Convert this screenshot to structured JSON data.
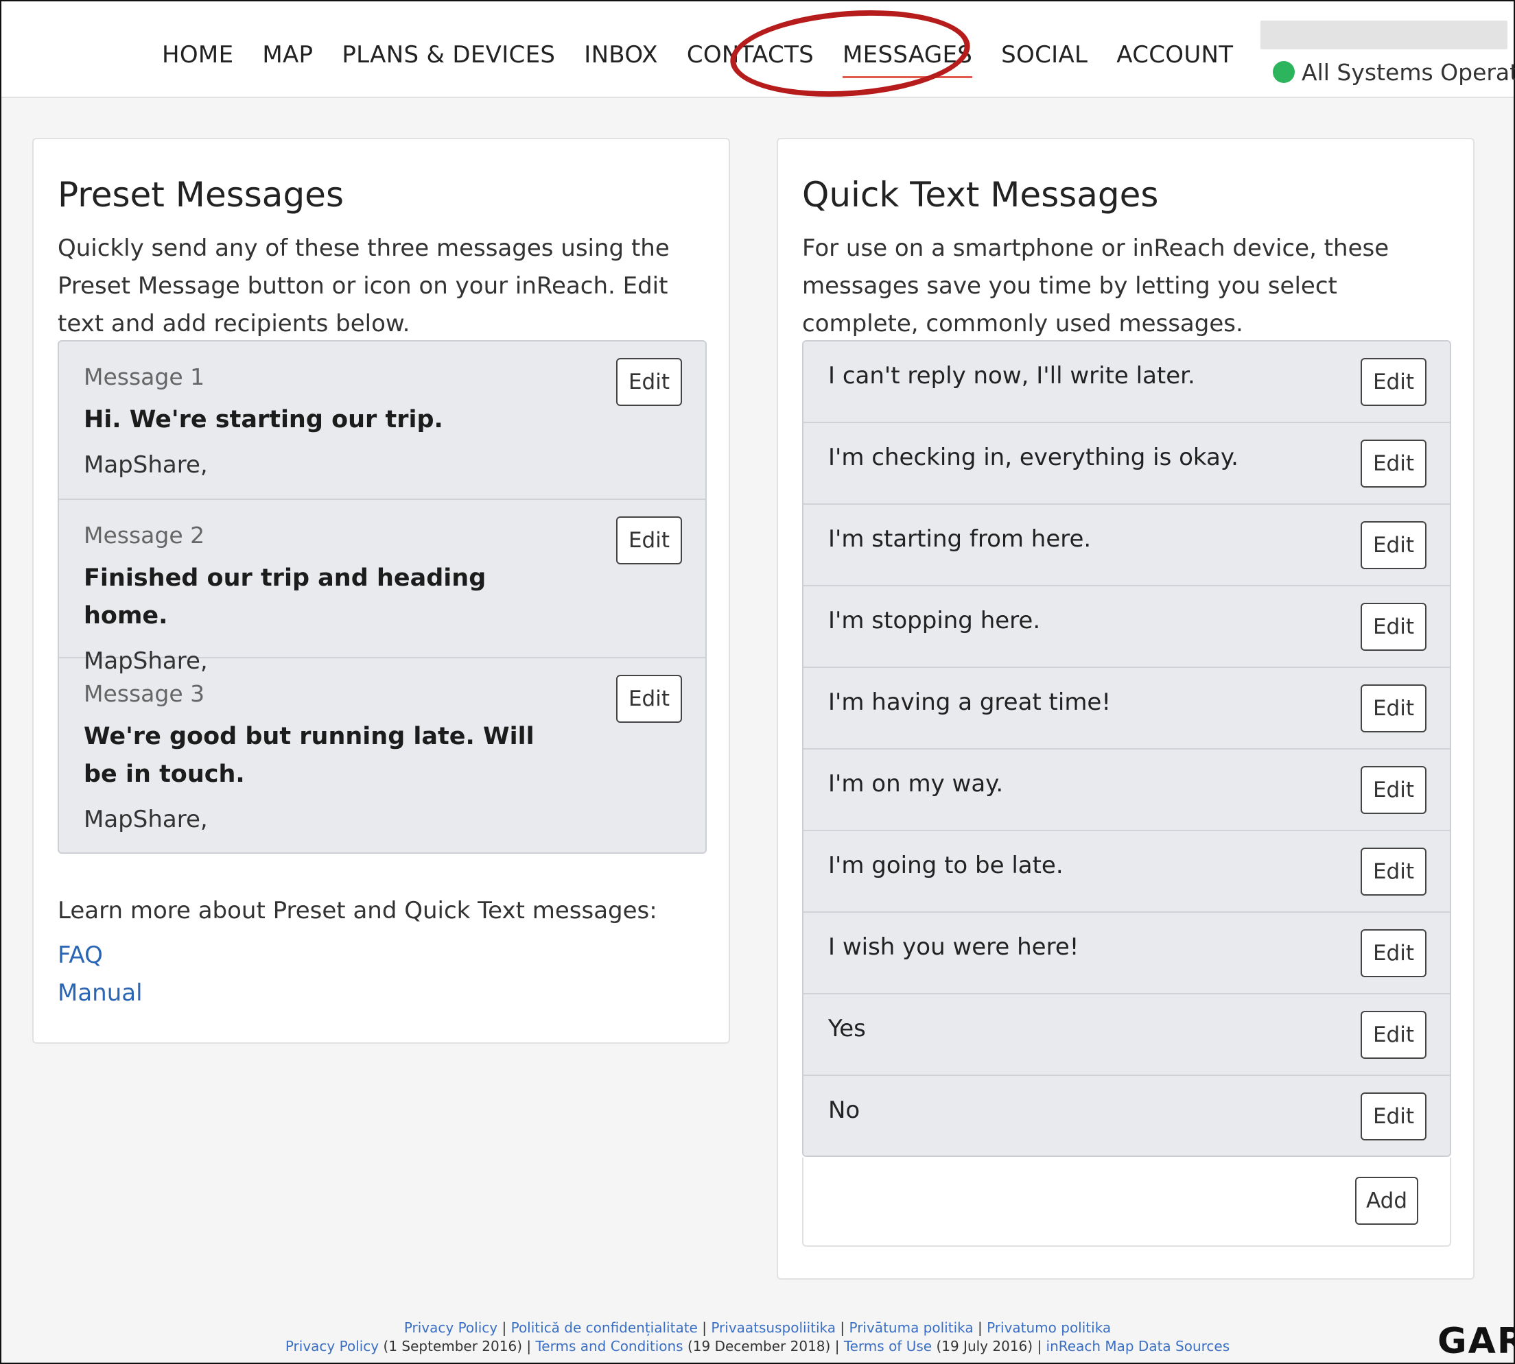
{
  "nav": {
    "items": [
      "HOME",
      "MAP",
      "PLANS & DEVICES",
      "INBOX",
      "CONTACTS",
      "MESSAGES",
      "SOCIAL",
      "ACCOUNT"
    ],
    "active": "MESSAGES"
  },
  "status": {
    "text": "All Systems Operati",
    "color": "#2db55d"
  },
  "annotation": {
    "color": "#b71c1c"
  },
  "preset": {
    "title": "Preset Messages",
    "description": "Quickly send any of these three messages using the Preset Message button or icon on your inReach. Edit text and add recipients below.",
    "messages": [
      {
        "label": "Message 1",
        "text": "Hi. We're starting our trip.",
        "recipients": "MapShare,",
        "edit_label": "Edit"
      },
      {
        "label": "Message 2",
        "text": "Finished our trip and heading home.",
        "recipients": "MapShare,",
        "edit_label": "Edit"
      },
      {
        "label": "Message 3",
        "text": "We're good but running late. Will be in touch.",
        "recipients": "MapShare,",
        "edit_label": "Edit"
      }
    ],
    "learn_more": "Learn more about Preset and Quick Text messages:",
    "links": {
      "faq": "FAQ",
      "manual": "Manual"
    }
  },
  "quick": {
    "title": "Quick Text Messages",
    "description": "For use on a smartphone or inReach device, these messages save you time by letting you select complete, commonly used messages.",
    "messages": [
      {
        "text": "I can't reply now, I'll write later.",
        "edit_label": "Edit"
      },
      {
        "text": "I'm checking in, everything is okay.",
        "edit_label": "Edit"
      },
      {
        "text": "I'm starting from here.",
        "edit_label": "Edit"
      },
      {
        "text": "I'm stopping here.",
        "edit_label": "Edit"
      },
      {
        "text": "I'm having a great time!",
        "edit_label": "Edit"
      },
      {
        "text": "I'm on my way.",
        "edit_label": "Edit"
      },
      {
        "text": "I'm going to be late.",
        "edit_label": "Edit"
      },
      {
        "text": "I wish you were here!",
        "edit_label": "Edit"
      },
      {
        "text": "Yes",
        "edit_label": "Edit"
      },
      {
        "text": "No",
        "edit_label": "Edit"
      }
    ],
    "add_label": "Add"
  },
  "footer": {
    "line1": [
      "Privacy Policy",
      "Politică de confidențialitate",
      "Privaatsuspoliitika",
      "Privātuma politika",
      "Privatumo politika"
    ],
    "line2": {
      "privacy": "Privacy Policy",
      "privacy_date": "(1 September 2016)",
      "terms": "Terms and Conditions",
      "terms_date": "(19 December 2018)",
      "use": "Terms of Use",
      "use_date": "(19 July 2016)",
      "sources": "inReach Map Data Sources"
    },
    "separator": "|"
  },
  "logo": "GAR"
}
